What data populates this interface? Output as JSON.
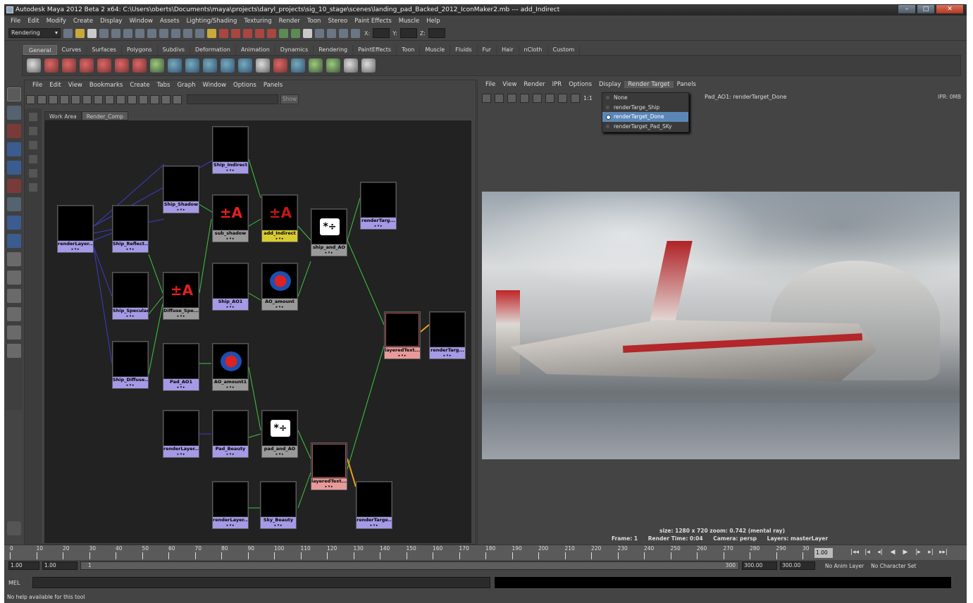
{
  "window": {
    "title": "Autodesk Maya 2012 Beta 2 x64: C:\\Users\\oberts\\Documents\\maya\\projects\\daryl_projects\\sig_10_stage\\scenes\\landing_pad_Backed_2012_IconMaker2.mb  ---  add_Indirect",
    "btn_min": "–",
    "btn_max": "□",
    "btn_close": "✕"
  },
  "menubar": [
    "File",
    "Edit",
    "Modify",
    "Create",
    "Display",
    "Window",
    "Assets",
    "Lighting/Shading",
    "Texturing",
    "Render",
    "Toon",
    "Stereo",
    "Paint Effects",
    "Muscle",
    "Help"
  ],
  "status_line": {
    "mode": "Rendering",
    "x_label": "X:",
    "y_label": "Y:",
    "z_label": "Z:"
  },
  "shelf_tabs": [
    "General",
    "Curves",
    "Surfaces",
    "Polygons",
    "Subdivs",
    "Deformation",
    "Animation",
    "Dynamics",
    "Rendering",
    "PaintEffects",
    "Toon",
    "Muscle",
    "Fluids",
    "Fur",
    "Hair",
    "nCloth",
    "Custom"
  ],
  "shelf_active": "General",
  "hypershade": {
    "menu": [
      "File",
      "Edit",
      "View",
      "Bookmarks",
      "Create",
      "Tabs",
      "Graph",
      "Window",
      "Options",
      "Panels"
    ],
    "show_label": "Show",
    "tabs": [
      "Work Area",
      "Render_Comp"
    ],
    "nodes": {
      "ship_indirect": "Ship_Indirect",
      "ship_shadow": "Ship_Shadow",
      "sub_shadow": "sub_shadow",
      "add_indirect": "add_Indirect",
      "ship_and_ao": "ship_and_AO",
      "render_target_top": "renderTarg...",
      "render_layer_left": "renderLayer...",
      "ship_reflect": "Ship_Reflect...",
      "ship_specular": "Ship_Specular",
      "diffuse_spec": "Diffuse_Spe...",
      "ship_ao1": "Ship_AO1",
      "ao_amount": "AO_amount",
      "layered_text_top": "layeredText...",
      "render_target_mid": "renderTarg...",
      "ship_diffuse": "Ship_Diffuse...",
      "pad_ao1": "Pad_AO1",
      "ao_amount1": "AO_amount1",
      "render_layer_pad": "renderLayer...",
      "pad_beauty": "Pad_Beauty",
      "pad_and_ao": "pad_and_AO",
      "layered_text_bot": "layeredText...",
      "render_layer_sky": "renderLayer...",
      "sky_beauty": "Sky_Beauty",
      "render_target_bot": "renderTarge..."
    },
    "plus_minus": "±A",
    "mult_div": "*÷",
    "plugs": "▸ ▾ ▸"
  },
  "render_view": {
    "menu": [
      "File",
      "View",
      "Render",
      "IPR",
      "Options",
      "Display",
      "Render Target",
      "Panels"
    ],
    "ratio": "1:1",
    "title": "Pad_AO1: renderTarget_Done",
    "ipr": "IPR: 0MB",
    "dropdown": [
      "None",
      "renderTarge_Ship",
      "renderTarget_Done",
      "renderTarget_Pad_SKy"
    ],
    "dropdown_selected": 2,
    "info_line1": "size: 1280 x 720  zoom: 0.742       (mental ray)",
    "frame": "Frame: 1",
    "render_time": "Render Time: 0:04",
    "camera": "Camera: persp",
    "layers": "Layers: masterLayer"
  },
  "timeline": {
    "ticks": [
      "0",
      "10",
      "20",
      "30",
      "40",
      "50",
      "60",
      "70",
      "80",
      "90",
      "100",
      "110",
      "120",
      "130",
      "140",
      "150",
      "160",
      "170",
      "180",
      "190",
      "200",
      "210",
      "220",
      "230",
      "240",
      "250",
      "260",
      "270",
      "280",
      "290",
      "30"
    ],
    "current": "1.00",
    "play": [
      "|◂◂",
      "|◂",
      "◂|",
      "◀",
      "▶",
      "|▸",
      "▸|",
      "▸▸|"
    ]
  },
  "range": {
    "start": "1.00",
    "start2": "1.00",
    "slider_start": "1",
    "slider_end": "300",
    "end": "300.00",
    "end2": "300.00",
    "anim_layer": "No Anim Layer",
    "char_set": "No Character Set"
  },
  "command": {
    "label": "MEL"
  },
  "help": "No help available for this tool"
}
